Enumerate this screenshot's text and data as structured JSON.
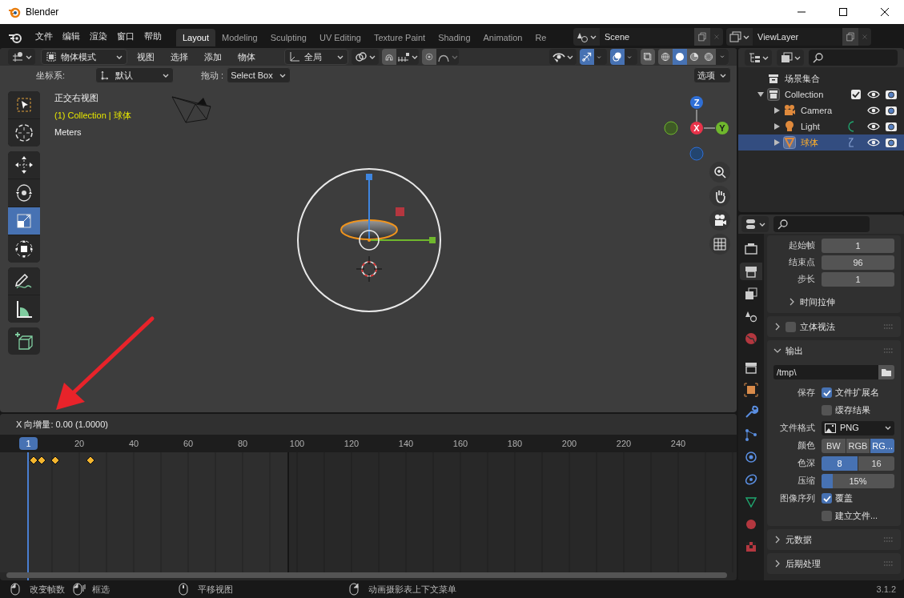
{
  "window": {
    "title": "Blender"
  },
  "menu": [
    "文件",
    "编辑",
    "渲染",
    "窗口",
    "帮助"
  ],
  "workspace_tabs": [
    {
      "label": "Layout",
      "selected": true
    },
    {
      "label": "Modeling",
      "selected": false
    },
    {
      "label": "Sculpting",
      "selected": false
    },
    {
      "label": "UV Editing",
      "selected": false
    },
    {
      "label": "Texture Paint",
      "selected": false
    },
    {
      "label": "Shading",
      "selected": false
    },
    {
      "label": "Animation",
      "selected": false
    },
    {
      "label": "Re",
      "selected": false
    }
  ],
  "scene": {
    "value": "Scene"
  },
  "view_layer": {
    "value": "ViewLayer"
  },
  "viewport": {
    "mode": "物体模式",
    "menus": [
      "视图",
      "选择",
      "添加",
      "物体"
    ],
    "orientation": "全局",
    "snap": {
      "on": false
    },
    "proportional_edit": {
      "on": false
    },
    "gizmos": {
      "on": true
    },
    "overlays": {
      "on": true
    },
    "shading_modes": [
      {
        "kind": "wireframe",
        "selected": false
      },
      {
        "kind": "solid",
        "selected": true
      },
      {
        "kind": "material",
        "selected": false
      },
      {
        "kind": "rendered",
        "selected": false
      }
    ],
    "coord_label": "坐标系:",
    "coord_value": "默认",
    "drag_label": "拖动 :",
    "drag_value": "Select Box",
    "options": "选项",
    "tools": [
      {
        "kind": "select",
        "selected": false
      },
      {
        "kind": "cursor",
        "selected": false
      },
      {
        "kind": "move",
        "selected": false
      },
      {
        "kind": "rotate",
        "selected": false
      },
      {
        "kind": "scale",
        "selected": true
      },
      {
        "kind": "transform",
        "selected": false
      },
      {
        "kind": "annotate",
        "selected": false
      },
      {
        "kind": "measure",
        "selected": false
      },
      {
        "kind": "add_cube",
        "selected": false
      }
    ],
    "view_name": "正交右视图",
    "object_info": "(1) Collection | 球体",
    "units": "Meters",
    "axes": [
      {
        "label": "Z",
        "color": "#2f6fd6"
      },
      {
        "label": "X",
        "color": "#e8334a"
      },
      {
        "label": "Y",
        "color": "#6fb72d"
      }
    ]
  },
  "timeline": {
    "operator_info": "X 向增量: 0.00 (1.0000)",
    "current_frame": "1",
    "ticks": [
      "20",
      "40",
      "60",
      "80",
      "100",
      "120",
      "140",
      "160",
      "180",
      "200",
      "220",
      "240"
    ]
  },
  "outliner": {
    "items": [
      {
        "label": "场景集合",
        "kind": "scene_collection",
        "selected": false,
        "children": [
          {
            "label": "Collection",
            "kind": "collection",
            "expanded": true,
            "checked": true,
            "selected": false,
            "children": [
              {
                "label": "Camera",
                "kind": "camera",
                "expanded": false,
                "selected": false
              },
              {
                "label": "Light",
                "kind": "light",
                "expanded": false,
                "selected": false
              },
              {
                "label": "球体",
                "kind": "mesh",
                "expanded": false,
                "selected": true
              }
            ]
          }
        ]
      }
    ]
  },
  "properties": {
    "tabs": [
      {
        "kind": "render",
        "selected": false
      },
      {
        "kind": "output",
        "selected": true
      },
      {
        "kind": "view_layer",
        "selected": false
      },
      {
        "kind": "scene",
        "selected": false
      },
      {
        "kind": "world",
        "selected": false
      },
      {
        "kind": "collection",
        "selected": false
      },
      {
        "kind": "object",
        "selected": false
      },
      {
        "kind": "modifier",
        "selected": false
      },
      {
        "kind": "particles",
        "selected": false
      },
      {
        "kind": "physics",
        "selected": false
      },
      {
        "kind": "constraints",
        "selected": false
      },
      {
        "kind": "data",
        "selected": false
      },
      {
        "kind": "material",
        "selected": false
      },
      {
        "kind": "texture",
        "selected": false
      }
    ],
    "rows": [
      {
        "kind": "field",
        "label": "起始帧",
        "value": "1"
      },
      {
        "kind": "field",
        "label": "结束点",
        "value": "96"
      },
      {
        "kind": "field",
        "label": "步长",
        "value": "1"
      },
      {
        "kind": "subpanel",
        "label": "时间拉伸",
        "expanded": false
      },
      {
        "kind": "panel",
        "label": "立体视法",
        "expanded": false,
        "checked": false
      },
      {
        "kind": "panel",
        "label": "输出",
        "expanded": true
      },
      {
        "kind": "path",
        "value": "/tmp\\"
      },
      {
        "kind": "checkbox",
        "label": "保存",
        "text": "文件扩展名",
        "checked": true
      },
      {
        "kind": "checkbox",
        "text": "缓存结果",
        "checked": false
      },
      {
        "kind": "select",
        "label": "文件格式",
        "value": "PNG"
      },
      {
        "kind": "segmented",
        "label": "颜色",
        "options": [
          {
            "label": "BW",
            "selected": false
          },
          {
            "label": "RGB",
            "selected": false
          },
          {
            "label": "RG...",
            "selected": true
          }
        ]
      },
      {
        "kind": "segmented",
        "label": "色深",
        "options": [
          {
            "label": "8",
            "selected": true
          },
          {
            "label": "16",
            "selected": false
          }
        ]
      },
      {
        "kind": "slider",
        "label": "压缩",
        "value": "15%",
        "level": 0.15
      },
      {
        "kind": "checkbox",
        "label": "图像序列",
        "text": "覆盖",
        "checked": true
      },
      {
        "kind": "checkbox",
        "text": "建立文件...",
        "checked": false
      },
      {
        "kind": "panel",
        "label": "元数据",
        "expanded": false
      },
      {
        "kind": "panel",
        "label": "后期处理",
        "expanded": false
      }
    ]
  },
  "status_bar": {
    "items": [
      {
        "kind": "left_click",
        "label": "改变帧数"
      },
      {
        "kind": "drag",
        "label": "框选"
      },
      {
        "kind": "middle_click",
        "label": "平移视图"
      },
      {
        "kind": "right_click",
        "label": "动画摄影表上下文菜单"
      }
    ],
    "version": "3.1.2"
  }
}
